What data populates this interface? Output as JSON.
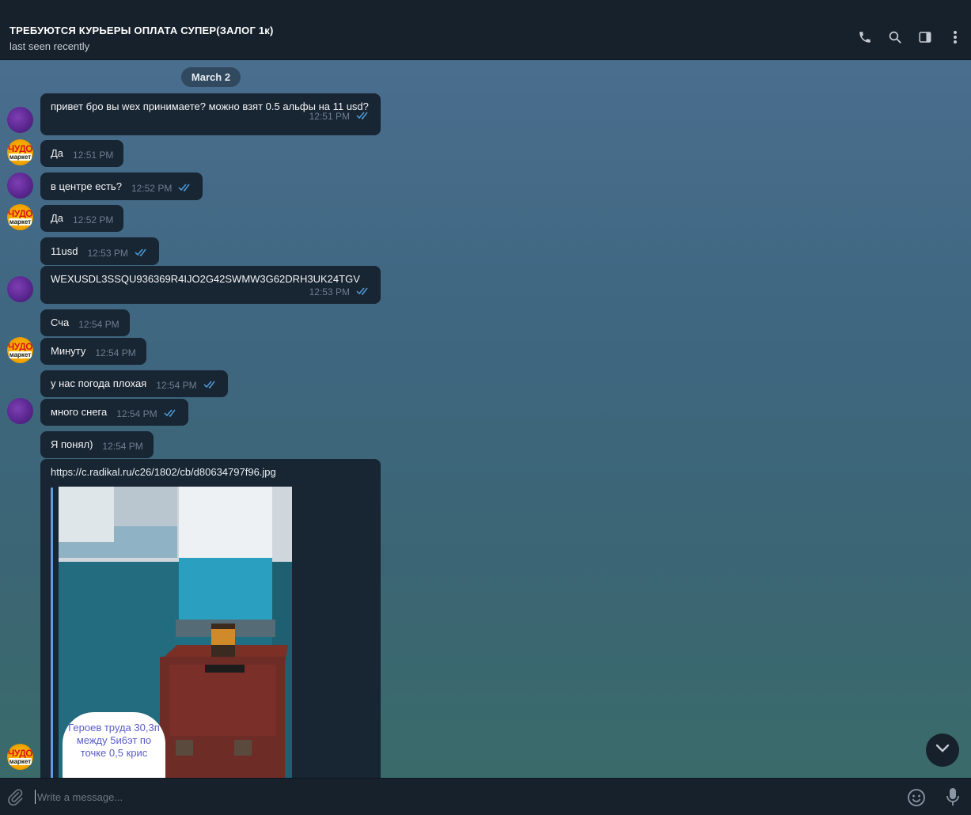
{
  "window": {
    "controls": {
      "minimize": "—",
      "restore": "❐",
      "close": "✕"
    }
  },
  "header": {
    "title": "ТРЕБУЮТСЯ КУРЬЕРЫ ОПЛАТА СУПЕР(ЗАЛОГ 1к)",
    "status": "last seen recently",
    "icons": [
      "phone-icon",
      "search-icon",
      "sidebar-toggle-icon",
      "more-vert-icon"
    ]
  },
  "chat": {
    "date": "March 2",
    "messages": [
      {
        "text": "привет бро вы wex принимаете? можно взят 0.5 альфы на 11 usd?",
        "time": "12:51 PM",
        "outgoing": true
      },
      {
        "text": "Да",
        "time": "12:51 PM",
        "outgoing": false
      },
      {
        "text": "в центре есть?",
        "time": "12:52 PM",
        "outgoing": true
      },
      {
        "text": "Да",
        "time": "12:52 PM",
        "outgoing": false
      },
      {
        "text": "11usd",
        "time": "12:53 PM",
        "outgoing": true
      },
      {
        "text": "WEXUSDL3SSQU936369R4IJO2G42SWMW3G62DRH3UK24TGV",
        "time": "12:53 PM",
        "outgoing": true
      },
      {
        "text": "Сча",
        "time": "12:54 PM",
        "outgoing": false
      },
      {
        "text": "Минуту",
        "time": "12:54 PM",
        "outgoing": false
      },
      {
        "text": "у нас погода плохая",
        "time": "12:54 PM",
        "outgoing": true
      },
      {
        "text": "много снега",
        "time": "12:54 PM",
        "outgoing": true
      },
      {
        "text": "Я понял)",
        "time": "12:54 PM",
        "outgoing": false
      }
    ],
    "link_message": {
      "url": "https://c.radikal.ru/c26/1802/cb/d80634797f96.jpg",
      "photo_note": "Героев труда 30,3п между 5и6эт по точке 0,5 крис"
    },
    "avatar_text": {
      "line1": "ЧУДО",
      "line2": "маркет"
    }
  },
  "composer": {
    "placeholder": "Write a message..."
  },
  "colors": {
    "background": "#17212b",
    "bubble": "#182533",
    "accent": "#5c9ce6",
    "read_check": "#4f9bd9"
  }
}
